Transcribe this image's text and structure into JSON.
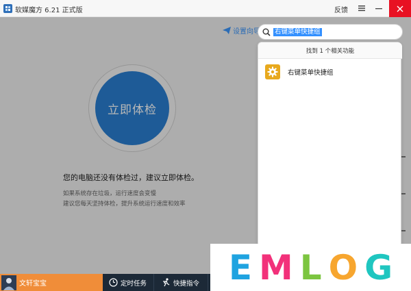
{
  "app": {
    "title": "软媒魔方 6.21 正式版",
    "feedback": "反馈"
  },
  "header": {
    "wizard_label": "设置向导"
  },
  "main": {
    "check_button_label": "立即体检",
    "status_text": "您的电脑还没有体检过，建议立即体检。",
    "tips": [
      "如果系统存在垃圾，运行速度会变慢",
      "建议您每天坚持体检，提升系统运行速度和效率"
    ]
  },
  "search": {
    "query": "右键菜单快捷组",
    "results_count": "找到 1 个相关功能",
    "results": [
      {
        "label": "右键菜单快捷组",
        "icon": "gear-icon"
      }
    ]
  },
  "bottombar": {
    "user_name": "文轩宝宝",
    "buttons": [
      {
        "label": "定时任务",
        "icon": "clock-icon"
      },
      {
        "label": "快捷指令",
        "icon": "running-man-icon"
      }
    ]
  },
  "watermark": {
    "letters": [
      {
        "char": "E",
        "color": "#1fa3e0"
      },
      {
        "char": "M",
        "color": "#f2317a"
      },
      {
        "char": "L",
        "color": "#7cc540"
      },
      {
        "char": "O",
        "color": "#f7a62f"
      },
      {
        "char": "G",
        "color": "#1fc6c0"
      }
    ]
  },
  "colors": {
    "accent": "#2a7fd1",
    "user_box": "#f08d39",
    "bottombar": "#1c2937",
    "close": "#e81123"
  }
}
